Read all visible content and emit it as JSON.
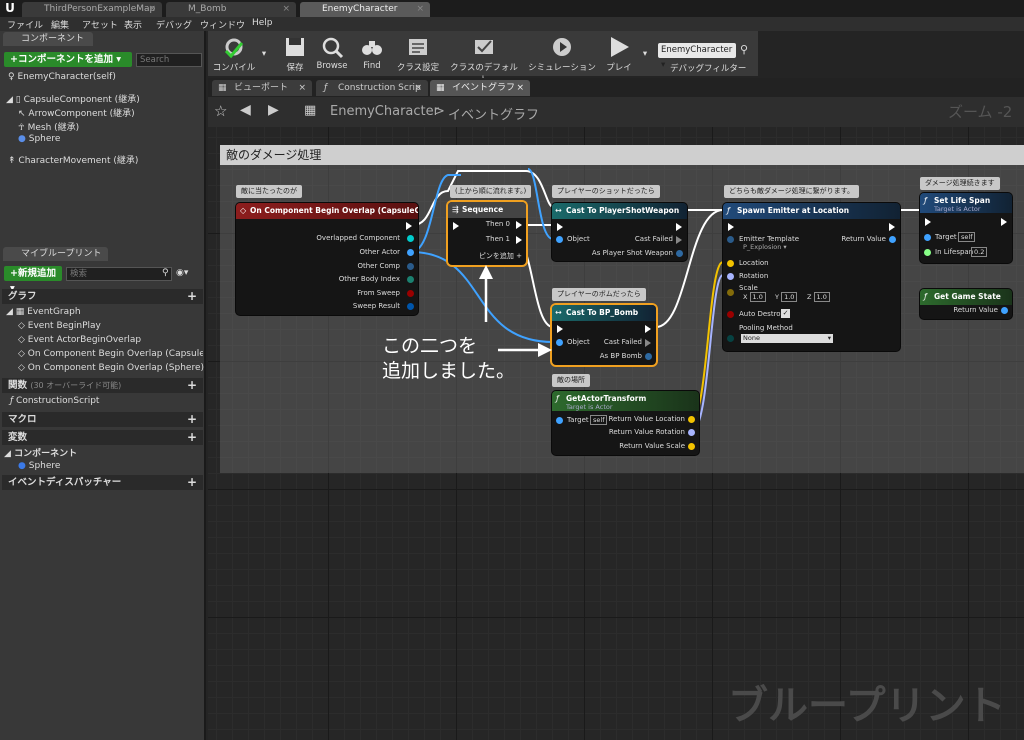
{
  "tabs": [
    {
      "label": "ThirdPersonExampleMap"
    },
    {
      "label": "M_Bomb"
    },
    {
      "label": "EnemyCharacter"
    }
  ],
  "menu": [
    "ファイル",
    "編集",
    "アセット",
    "表示",
    "デバッグ",
    "ウィンドウ",
    "Help"
  ],
  "left": {
    "components_tab": "コンポーネント",
    "add_component": "+コンポーネントを追加 ▾",
    "search_placeholder": "Search",
    "tree": [
      "EnemyCharacter(self)",
      "CapsuleComponent (継承)",
      "ArrowComponent (継承)",
      "Mesh (継承)",
      "Sphere",
      "CharacterMovement (継承)"
    ],
    "mybp_tab": "マイブループリント",
    "add_new": "+新規追加 ▾",
    "search2_placeholder": "検索",
    "graph_cat": "グラフ",
    "eventgraph": "EventGraph",
    "events": [
      "Event BeginPlay",
      "Event ActorBeginOverlap",
      "On Component Begin Overlap (CapsuleCo",
      "On Component Begin Overlap (Sphere)"
    ],
    "func_cat": "関数",
    "func_note": "(30 オーバーライド可能)",
    "construction": "ConstructionScript",
    "macro_cat": "マクロ",
    "var_cat": "変数",
    "comp_cat": "コンポーネント",
    "comp_sphere": "Sphere",
    "dispatch_cat": "イベントディスパッチャー"
  },
  "toolbar": {
    "compile": "コンパイル",
    "save": "保存",
    "browse": "Browse",
    "find": "Find",
    "class_settings": "クラス設定",
    "class_defaults": "クラスのデフォルト",
    "simulation": "シミュレーション",
    "play": "プレイ",
    "debug_target": "EnemyCharacter ▾",
    "debug_filter": "デバッグフィルター"
  },
  "graphtabs": [
    "ビューポート",
    "Construction Scrip",
    "イベントグラフ"
  ],
  "graph": {
    "breadcrumb_root": "EnemyCharacter",
    "breadcrumb_sep": ">",
    "breadcrumb_leaf": "イベントグラフ",
    "zoom": "ズーム -2",
    "comment_title": "敵のダメージ処理",
    "watermark": "ブループリント",
    "annotation_line1": "この二つを",
    "annotation_line2": "追加しました。"
  },
  "bubbles": {
    "b1": "敵に当たったのが",
    "b2": "(上から順に流れます。)",
    "b3": "プレイヤーのショットだったら",
    "b4": "どちらも敵ダメージ処理に繋がります。",
    "b5": "ダメージ処理続きます",
    "b6": "プレイヤーのボムだったら",
    "b7": "敵の場所"
  },
  "nodes": {
    "overlap": {
      "title": "On Component Begin Overlap (CapsuleComponent)",
      "pins": [
        "Overlapped Component",
        "Other Actor",
        "Other Comp",
        "Other Body Index",
        "From Sweep",
        "Sweep Result"
      ]
    },
    "sequence": {
      "title": "Sequence",
      "pins": [
        "Then 0",
        "Then 1"
      ],
      "add": "ピンを追加 +"
    },
    "cast_shot": {
      "title": "Cast To PlayerShotWeapon",
      "object": "Object",
      "failed": "Cast Failed",
      "as": "As Player Shot Weapon"
    },
    "cast_bomb": {
      "title": "Cast To BP_Bomb",
      "object": "Object",
      "failed": "Cast Failed",
      "as": "As BP Bomb"
    },
    "transform": {
      "title": "GetActorTransform",
      "sub": "Target is Actor",
      "target": "Target",
      "self": "self",
      "loc": "Return Value Location",
      "rot": "Return Value Rotation",
      "scale": "Return Value Scale"
    },
    "spawn": {
      "title": "Spawn Emitter at Location",
      "template": "Emitter Template",
      "template_val": "P_Explosion ▾",
      "ret": "Return Value",
      "location": "Location",
      "rotation": "Rotation",
      "scale": "Scale",
      "sx": "1.0",
      "sy": "1.0",
      "sz": "1.0",
      "x": "X",
      "y": "Y",
      "z": "Z",
      "auto_destroy": "Auto Destroy",
      "pooling": "Pooling Method",
      "pooling_val": "None"
    },
    "lifespan": {
      "title": "Set Life Span",
      "sub": "Target is Actor",
      "target": "Target",
      "self": "self",
      "in": "In Lifespan",
      "val": "0.2"
    },
    "gamebase": {
      "title": "Get Game State",
      "ret": "Return Value"
    }
  }
}
